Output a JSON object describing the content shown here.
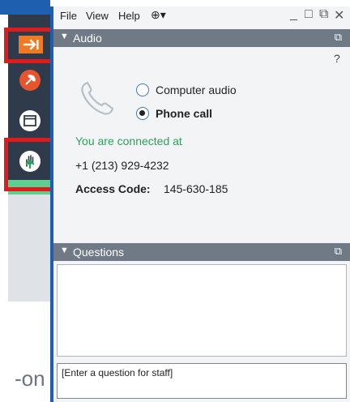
{
  "menu": {
    "file": "File",
    "view": "View",
    "help": "Help",
    "globe": "⊕▾"
  },
  "window_controls": {
    "minimize": "_",
    "restore": "□",
    "popout": "⧉",
    "close": "✕"
  },
  "audio": {
    "title": "Audio",
    "help": "?",
    "computer_audio_label": "Computer audio",
    "phone_call_label": "Phone call",
    "selected_option": "Phone call",
    "connected_label": "You are connected at",
    "phone_number": "+1 (213) 929-4232",
    "access_code_label": "Access Code:",
    "access_code_value": "145-630-185"
  },
  "questions": {
    "title": "Questions",
    "input_placeholder": "[Enter a question for staff]"
  },
  "background_text": "-on",
  "colors": {
    "accent_blue": "#1f5fb0",
    "header_gray": "#707a86",
    "highlight_red": "#e11b1b",
    "connected_green": "#2fa25b",
    "rail_dark": "#2f3b4a"
  },
  "rail_icons": [
    "arrow-right-icon",
    "hangup-phone-icon",
    "window-icon",
    "raise-hand-icon"
  ]
}
